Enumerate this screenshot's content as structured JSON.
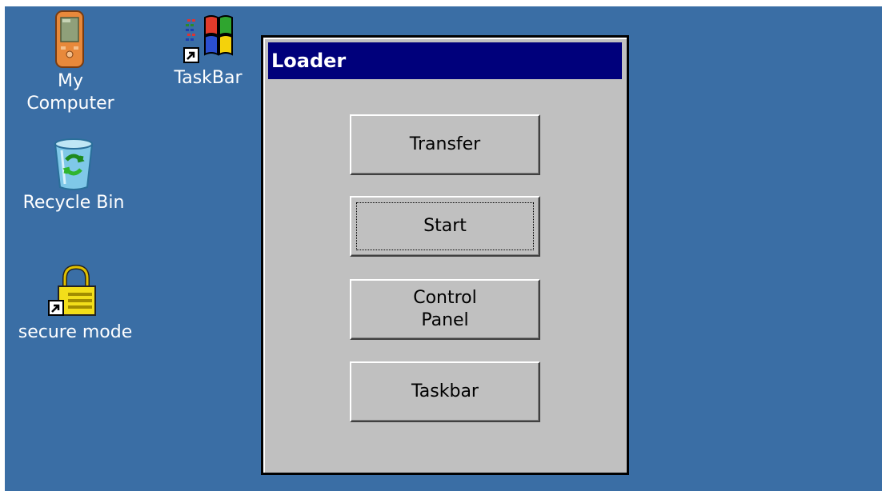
{
  "desktop": {
    "icons": [
      {
        "id": "my-computer",
        "label": "My\nComputer",
        "icon": "pda-device-icon"
      },
      {
        "id": "taskbar",
        "label": "TaskBar",
        "icon": "windows-flag-shortcut-icon"
      },
      {
        "id": "recycle",
        "label": "Recycle Bin",
        "icon": "recycle-bin-icon"
      },
      {
        "id": "secure",
        "label": "secure mode",
        "icon": "padlock-shortcut-icon"
      }
    ]
  },
  "window": {
    "title": "Loader",
    "buttons": {
      "transfer": "Transfer",
      "start": "Start",
      "control_panel": "Control\nPanel",
      "taskbar": "Taskbar"
    },
    "focused_button": "start"
  },
  "colors": {
    "desktop": "#3a6ea5",
    "titlebar": "#00007b",
    "window_face": "#c0c0c0"
  }
}
